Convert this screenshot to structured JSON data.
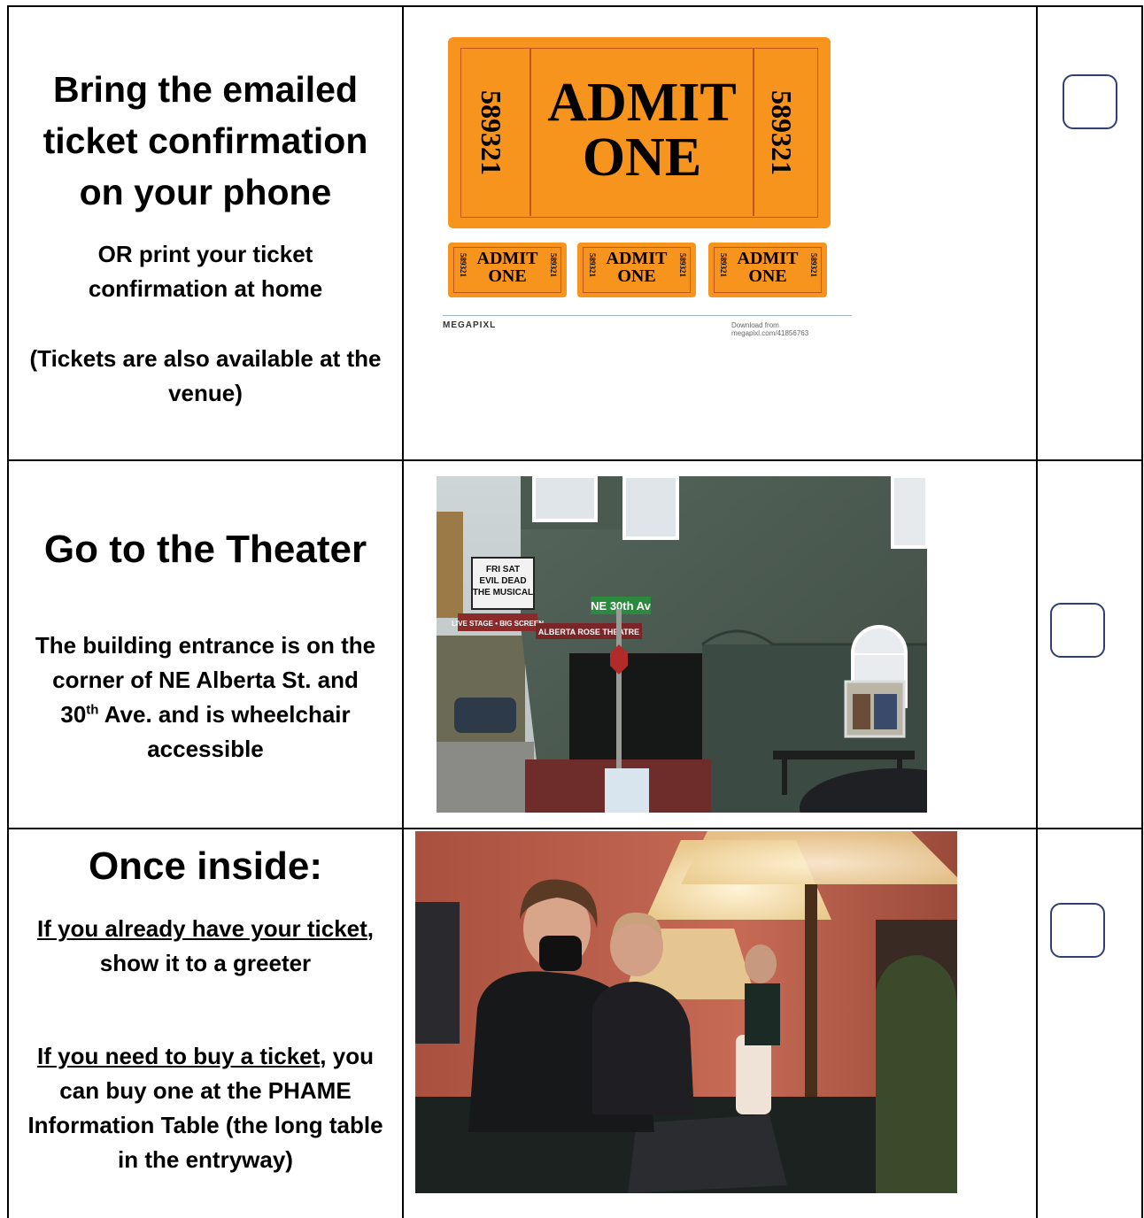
{
  "row1": {
    "heading": "Bring the emailed ticket confirmation on your phone",
    "line2": "OR print your ticket confirmation at home",
    "line3": "(Tickets are also available at the venue)",
    "ticket": {
      "main_admit": "ADMIT",
      "main_one": "ONE",
      "serial": "589321",
      "small_admit": "ADMIT",
      "small_one": "ONE",
      "brand": "MEGAPIXL",
      "download": "Download from megapixl.com/41856763"
    }
  },
  "row2": {
    "heading": "Go to the Theater",
    "line_a": "The building entrance is on the corner of NE Alberta St. and",
    "num": "30",
    "sup": "th",
    "line_b": " Ave. and is wheelchair accessible",
    "photo": {
      "marquee1": "FRI SAT",
      "marquee2": "EVIL DEAD",
      "marquee3": "THE MUSICAL",
      "street_sign": "NE 30th Av",
      "theater_sign": "ALBERTA ROSE THEATRE",
      "stage_sign": "LIVE STAGE • BIG SCREEN"
    }
  },
  "row3": {
    "heading": "Once inside:",
    "p1_u": "If you already have your ticket",
    "p1_rest": ", show it to a greeter",
    "p2_u": "If you need to buy a ticket",
    "p2_rest": ", you can buy one at the PHAME Information Table (the long table in the entryway)"
  },
  "colors": {
    "ticket_orange": "#f7941d",
    "checkbox_border": "#2f3e74"
  }
}
